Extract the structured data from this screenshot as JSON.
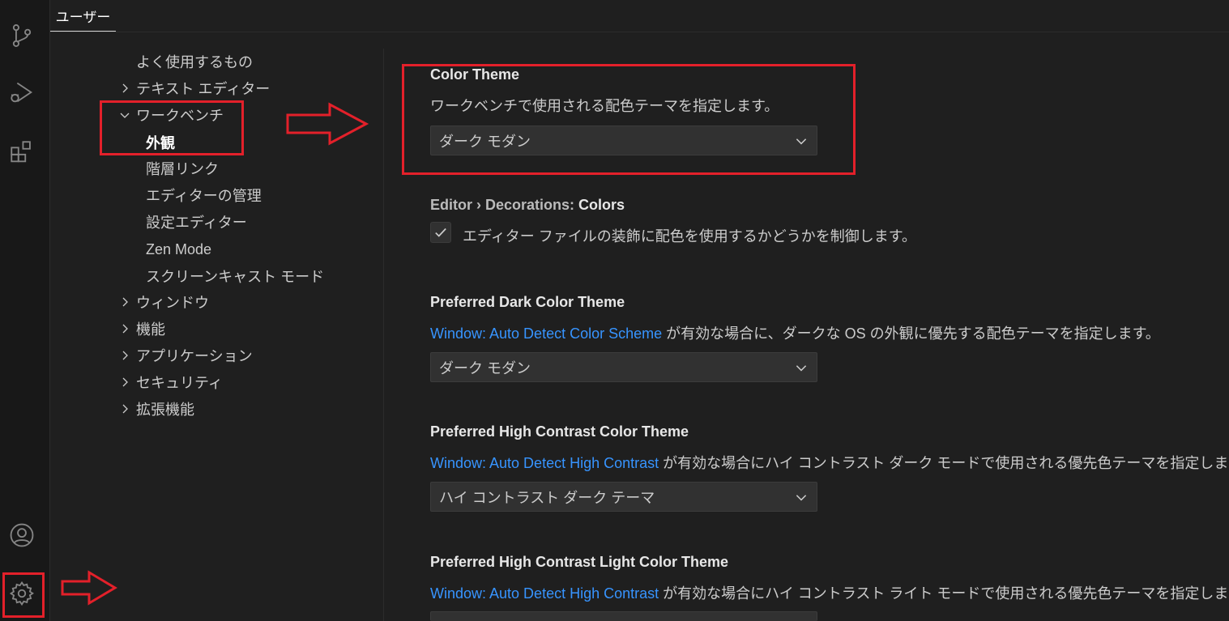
{
  "activity_bar": {
    "icons": [
      "source-control-icon",
      "run-debug-icon",
      "extensions-icon",
      "account-icon",
      "settings-gear-icon"
    ]
  },
  "tabs": {
    "user": "ユーザー"
  },
  "toc": {
    "items": [
      {
        "label": "よく使用するもの",
        "expandable": false,
        "level": 0
      },
      {
        "label": "テキスト エディター",
        "expandable": true,
        "expanded": false,
        "level": 0
      },
      {
        "label": "ワークベンチ",
        "expandable": true,
        "expanded": true,
        "level": 0
      },
      {
        "label": "外観",
        "expandable": false,
        "level": 1,
        "active": true
      },
      {
        "label": "階層リンク",
        "expandable": false,
        "level": 1
      },
      {
        "label": "エディターの管理",
        "expandable": false,
        "level": 1
      },
      {
        "label": "設定エディター",
        "expandable": false,
        "level": 1
      },
      {
        "label": "Zen Mode",
        "expandable": false,
        "level": 1
      },
      {
        "label": "スクリーンキャスト モード",
        "expandable": false,
        "level": 1
      },
      {
        "label": "ウィンドウ",
        "expandable": true,
        "expanded": false,
        "level": 0
      },
      {
        "label": "機能",
        "expandable": true,
        "expanded": false,
        "level": 0
      },
      {
        "label": "アプリケーション",
        "expandable": true,
        "expanded": false,
        "level": 0
      },
      {
        "label": "セキュリティ",
        "expandable": true,
        "expanded": false,
        "level": 0
      },
      {
        "label": "拡張機能",
        "expandable": true,
        "expanded": false,
        "level": 0
      }
    ]
  },
  "settings": {
    "color_theme": {
      "title": "Color Theme",
      "description": "ワークベンチで使用される配色テーマを指定します。",
      "value": "ダーク モダン"
    },
    "decorations_colors": {
      "category": "Editor › Decorations: ",
      "title": "Colors",
      "description": "エディター ファイルの装飾に配色を使用するかどうかを制御します。",
      "checked": true
    },
    "preferred_dark": {
      "title": "Preferred Dark Color Theme",
      "link": "Window: Auto Detect Color Scheme",
      "description_rest": " が有効な場合に、ダークな OS の外観に優先する配色テーマを指定します。",
      "value": "ダーク モダン"
    },
    "preferred_hc": {
      "title": "Preferred High Contrast Color Theme",
      "link": "Window: Auto Detect High Contrast",
      "description_rest": " が有効な場合にハイ コントラスト ダーク モードで使用される優先色テーマを指定します。",
      "value": "ハイ コントラスト ダーク テーマ"
    },
    "preferred_hc_light": {
      "title": "Preferred High Contrast Light Color Theme",
      "link": "Window: Auto Detect High Contrast",
      "description_rest": " が有効な場合にハイ コントラスト ライト モードで使用される優先色テーマを指定します。"
    }
  },
  "colors": {
    "background": "#1f1f1f",
    "activity_bar": "#181818",
    "link": "#3794ff",
    "annotation_red": "#e3202a"
  }
}
